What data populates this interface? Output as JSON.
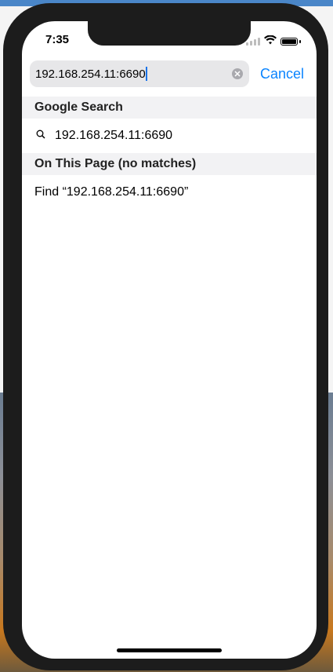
{
  "status_bar": {
    "time": "7:35"
  },
  "search": {
    "query": "192.168.254.11:6690",
    "cancel_label": "Cancel"
  },
  "sections": {
    "google": {
      "header": "Google Search",
      "suggestion": "192.168.254.11:6690"
    },
    "on_page": {
      "header": "On This Page (no matches)",
      "find": "Find “192.168.254.11:6690”"
    }
  },
  "colors": {
    "accent": "#0a84ff",
    "caret": "#1a73e8"
  },
  "icons": {
    "search": "magnifier-icon",
    "clear": "clear-x-icon",
    "wifi": "wifi-icon",
    "battery": "battery-icon",
    "signal": "signal-icon"
  }
}
